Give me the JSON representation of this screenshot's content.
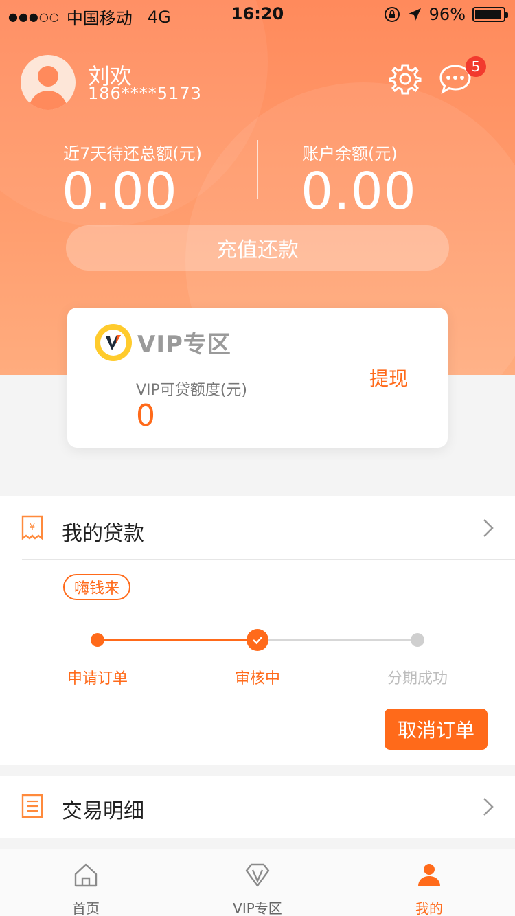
{
  "status_bar": {
    "signal": "●●●○○",
    "carrier": "中国移动",
    "network": "4G",
    "time": "16:20",
    "battery": "96%"
  },
  "profile": {
    "name": "刘欢",
    "phone": "186****5173",
    "message_badge": "5"
  },
  "summary": {
    "due_label": "近7天待还总额(元)",
    "due_value": "0.00",
    "balance_label": "账户余额(元)",
    "balance_value": "0.00",
    "recharge_button": "充值还款"
  },
  "vip": {
    "title": "VIP专区",
    "quota_label": "VIP可贷额度(元)",
    "quota_value": "0",
    "withdraw": "提现"
  },
  "loan": {
    "title": "我的贷款",
    "tag": "嗨钱来",
    "steps": [
      "申请订单",
      "审核中",
      "分期成功"
    ],
    "current_step_index": 1,
    "cancel_button": "取消订单"
  },
  "transactions": {
    "title": "交易明细"
  },
  "tabbar": {
    "items": [
      {
        "label": "首页",
        "icon": "home-icon"
      },
      {
        "label": "VIP专区",
        "icon": "vip-diamond-icon"
      },
      {
        "label": "我的",
        "icon": "user-icon"
      }
    ],
    "active_index": 2
  },
  "colors": {
    "accent": "#ff6a1a",
    "header_top": "#ff8a5c",
    "header_bottom": "#ffac7e",
    "badge": "#f23a2e"
  }
}
